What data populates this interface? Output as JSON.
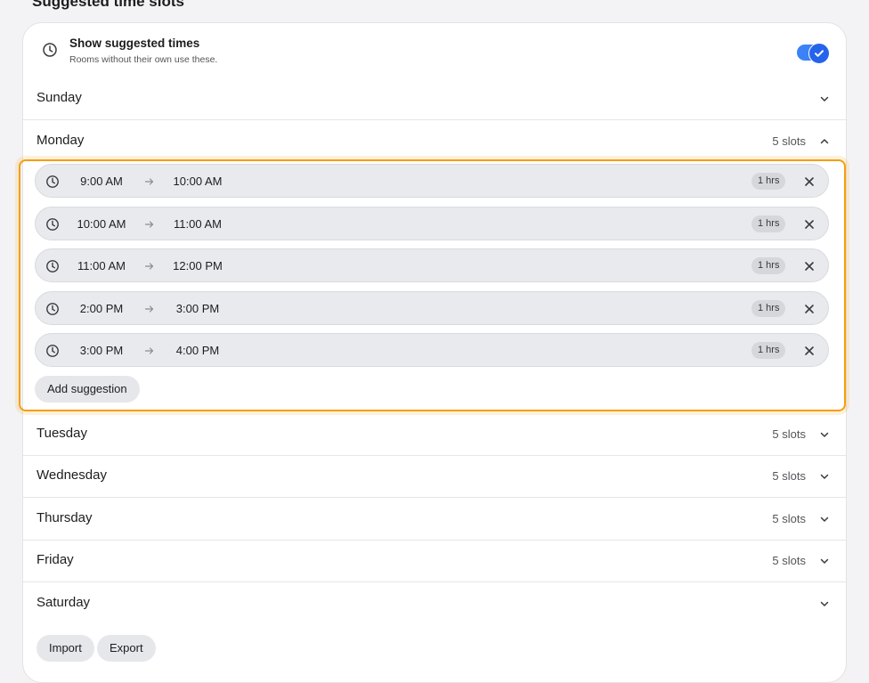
{
  "section": {
    "title": "Suggested time slots"
  },
  "toggle": {
    "title": "Show suggested times",
    "subtitle": "Rooms without their own use these.",
    "enabled": true,
    "icon": "clock-icon"
  },
  "colors": {
    "accent": "#3b82f6",
    "highlight": "#f59e0b",
    "slot_bg": "#e9eaee"
  },
  "days": [
    {
      "name": "Sunday",
      "count": "",
      "expanded": false
    },
    {
      "name": "Monday",
      "count": "5 slots",
      "expanded": true
    },
    {
      "name": "Tuesday",
      "count": "5 slots",
      "expanded": false
    },
    {
      "name": "Wednesday",
      "count": "5 slots",
      "expanded": false
    },
    {
      "name": "Thursday",
      "count": "5 slots",
      "expanded": false
    },
    {
      "name": "Friday",
      "count": "5 slots",
      "expanded": false
    },
    {
      "name": "Saturday",
      "count": "",
      "expanded": false
    }
  ],
  "monday_slots": [
    {
      "start": "9:00 AM",
      "end": "10:00 AM",
      "duration": "1 hrs"
    },
    {
      "start": "10:00 AM",
      "end": "11:00 AM",
      "duration": "1 hrs"
    },
    {
      "start": "11:00 AM",
      "end": "12:00 PM",
      "duration": "1 hrs"
    },
    {
      "start": "2:00 PM",
      "end": "3:00 PM",
      "duration": "1 hrs"
    },
    {
      "start": "3:00 PM",
      "end": "4:00 PM",
      "duration": "1 hrs"
    }
  ],
  "buttons": {
    "add_suggestion": "Add suggestion",
    "import": "Import",
    "export": "Export"
  }
}
